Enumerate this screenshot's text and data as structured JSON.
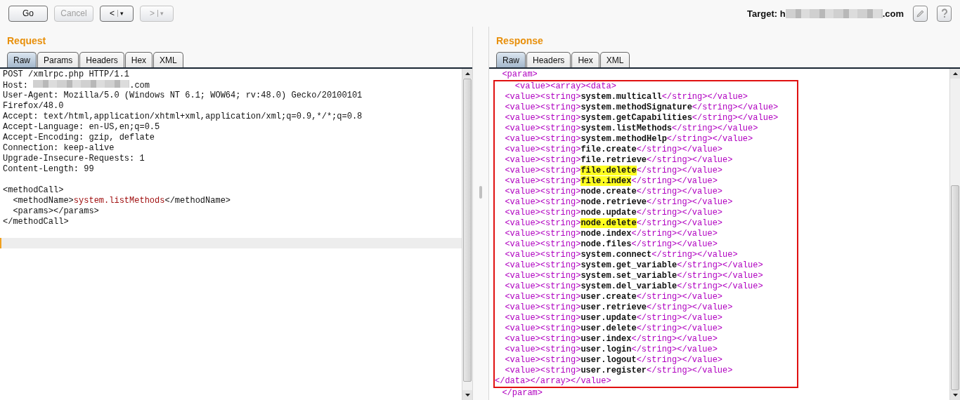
{
  "toolbar": {
    "buttons": [
      {
        "kind": "text",
        "label": "Go",
        "disabled": false
      },
      {
        "kind": "text",
        "label": "Cancel",
        "disabled": true
      },
      {
        "kind": "history",
        "arrow": "<",
        "caret": "▾",
        "disabled": false
      },
      {
        "kind": "history",
        "arrow": ">",
        "caret": "▾",
        "disabled": true
      }
    ],
    "target": {
      "label": "Target:",
      "prefix": "h",
      "suffix": ".com"
    }
  },
  "request": {
    "title": "Request",
    "tabs": [
      {
        "label": "Raw",
        "selected": true
      },
      {
        "label": "Params",
        "selected": false
      },
      {
        "label": "Headers",
        "selected": false
      },
      {
        "label": "Hex",
        "selected": false
      },
      {
        "label": "XML",
        "selected": false
      }
    ],
    "lines": [
      {
        "kind": "plain",
        "text": "POST /xmlrpc.php HTTP/1.1"
      },
      {
        "kind": "redacted",
        "text": "Host: ",
        "suffix": ".com"
      },
      {
        "kind": "plain",
        "text": "User-Agent: Mozilla/5.0 (Windows NT 6.1; WOW64; rv:48.0) Gecko/20100101"
      },
      {
        "kind": "plain",
        "text": "Firefox/48.0"
      },
      {
        "kind": "plain",
        "text": "Accept: text/html,application/xhtml+xml,application/xml;q=0.9,*/*;q=0.8"
      },
      {
        "kind": "plain",
        "text": "Accept-Language: en-US,en;q=0.5"
      },
      {
        "kind": "plain",
        "text": "Accept-Encoding: gzip, deflate"
      },
      {
        "kind": "plain",
        "text": "Connection: keep-alive"
      },
      {
        "kind": "plain",
        "text": "Upgrade-Insecure-Requests: 1"
      },
      {
        "kind": "plain",
        "text": "Content-Length: 99"
      },
      {
        "kind": "blank"
      },
      {
        "kind": "plain",
        "text": "<methodCall>"
      },
      {
        "kind": "value",
        "text": "  <methodName>",
        "value": "system.listMethods",
        "suffix": "</methodName>"
      },
      {
        "kind": "plain",
        "text": "  <params></params>"
      },
      {
        "kind": "plain",
        "text": "</methodCall>"
      },
      {
        "kind": "blank"
      },
      {
        "kind": "cursor"
      }
    ]
  },
  "response": {
    "title": "Response",
    "tabs": [
      {
        "label": "Raw",
        "selected": true
      },
      {
        "label": "Headers",
        "selected": false
      },
      {
        "label": "Hex",
        "selected": false
      },
      {
        "label": "XML",
        "selected": false
      }
    ],
    "before": [
      {
        "kind": "tag",
        "text": "  <param>"
      }
    ],
    "boxed": [
      {
        "kind": "tag",
        "text": "    <value><array><data>"
      },
      {
        "kind": "entry",
        "open": "  <value><string>",
        "name": "system.multicall",
        "close": "</string></value>",
        "highlighted": false
      },
      {
        "kind": "entry",
        "open": "  <value><string>",
        "name": "system.methodSignature",
        "close": "</string></value>",
        "highlighted": false
      },
      {
        "kind": "entry",
        "open": "  <value><string>",
        "name": "system.getCapabilities",
        "close": "</string></value>",
        "highlighted": false
      },
      {
        "kind": "entry",
        "open": "  <value><string>",
        "name": "system.listMethods",
        "close": "</string></value>",
        "highlighted": false
      },
      {
        "kind": "entry",
        "open": "  <value><string>",
        "name": "system.methodHelp",
        "close": "</string></value>",
        "highlighted": false
      },
      {
        "kind": "entry",
        "open": "  <value><string>",
        "name": "file.create",
        "close": "</string></value>",
        "highlighted": false
      },
      {
        "kind": "entry",
        "open": "  <value><string>",
        "name": "file.retrieve",
        "close": "</string></value>",
        "highlighted": false
      },
      {
        "kind": "entry",
        "open": "  <value><string>",
        "name": "file.delete",
        "close": "</string></value>",
        "highlighted": true
      },
      {
        "kind": "entry",
        "open": "  <value><string>",
        "name": "file.index",
        "close": "</string></value>",
        "highlighted": true
      },
      {
        "kind": "entry",
        "open": "  <value><string>",
        "name": "node.create",
        "close": "</string></value>",
        "highlighted": false
      },
      {
        "kind": "entry",
        "open": "  <value><string>",
        "name": "node.retrieve",
        "close": "</string></value>",
        "highlighted": false
      },
      {
        "kind": "entry",
        "open": "  <value><string>",
        "name": "node.update",
        "close": "</string></value>",
        "highlighted": false
      },
      {
        "kind": "entry",
        "open": "  <value><string>",
        "name": "node.delete",
        "close": "</string></value>",
        "highlighted": true
      },
      {
        "kind": "entry",
        "open": "  <value><string>",
        "name": "node.index",
        "close": "</string></value>",
        "highlighted": false
      },
      {
        "kind": "entry",
        "open": "  <value><string>",
        "name": "node.files",
        "close": "</string></value>",
        "highlighted": false
      },
      {
        "kind": "entry",
        "open": "  <value><string>",
        "name": "system.connect",
        "close": "</string></value>",
        "highlighted": false
      },
      {
        "kind": "entry",
        "open": "  <value><string>",
        "name": "system.get_variable",
        "close": "</string></value>",
        "highlighted": false
      },
      {
        "kind": "entry",
        "open": "  <value><string>",
        "name": "system.set_variable",
        "close": "</string></value>",
        "highlighted": false
      },
      {
        "kind": "entry",
        "open": "  <value><string>",
        "name": "system.del_variable",
        "close": "</string></value>",
        "highlighted": false
      },
      {
        "kind": "entry",
        "open": "  <value><string>",
        "name": "user.create",
        "close": "</string></value>",
        "highlighted": false
      },
      {
        "kind": "entry",
        "open": "  <value><string>",
        "name": "user.retrieve",
        "close": "</string></value>",
        "highlighted": false
      },
      {
        "kind": "entry",
        "open": "  <value><string>",
        "name": "user.update",
        "close": "</string></value>",
        "highlighted": false
      },
      {
        "kind": "entry",
        "open": "  <value><string>",
        "name": "user.delete",
        "close": "</string></value>",
        "highlighted": false
      },
      {
        "kind": "entry",
        "open": "  <value><string>",
        "name": "user.index",
        "close": "</string></value>",
        "highlighted": false
      },
      {
        "kind": "entry",
        "open": "  <value><string>",
        "name": "user.login",
        "close": "</string></value>",
        "highlighted": false
      },
      {
        "kind": "entry",
        "open": "  <value><string>",
        "name": "user.logout",
        "close": "</string></value>",
        "highlighted": false
      },
      {
        "kind": "entry",
        "open": "  <value><string>",
        "name": "user.register",
        "close": "</string></value>",
        "highlighted": false
      },
      {
        "kind": "tag",
        "text": "</data></array></value>"
      }
    ],
    "after": [
      {
        "kind": "tag",
        "text": "  </param>"
      }
    ]
  }
}
